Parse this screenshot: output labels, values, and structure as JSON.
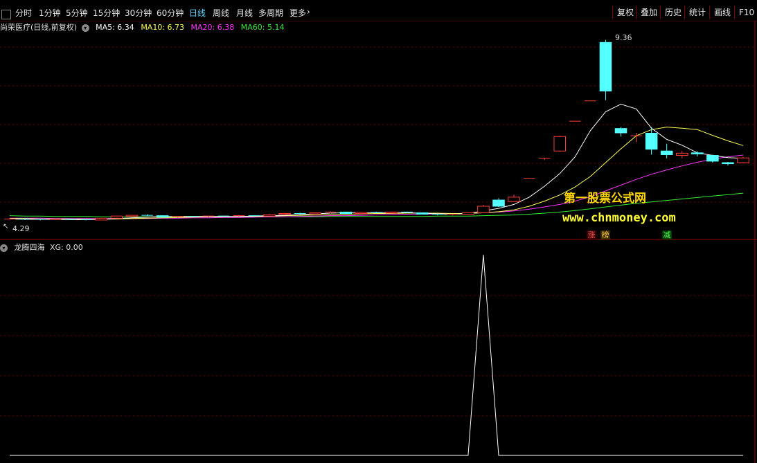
{
  "toolbar": {
    "periods": [
      "分时",
      "1分钟",
      "5分钟",
      "15分钟",
      "30分钟",
      "60分钟",
      "日线",
      "周线",
      "月线",
      "多周期",
      "更多"
    ],
    "active_index": 6,
    "right_buttons": [
      "复权",
      "叠加",
      "历史",
      "统计",
      "画线",
      "F10"
    ]
  },
  "main_info": {
    "title": "尚荣医疗(日线,前复权)",
    "ma5": "MA5: 6.34",
    "ma10": "MA10: 6.73",
    "ma20": "MA20: 6.38",
    "ma60": "MA60: 5.14"
  },
  "price_labels": {
    "high": "9.36",
    "low": "4.29"
  },
  "tags": {
    "zhang": "涨",
    "bang": "榜",
    "jian": "减"
  },
  "watermark": {
    "cn": "第一股票公式网",
    "url": "www.chnmoney.com"
  },
  "indicator_info": {
    "title": "龙腾四海",
    "xg": "XG: 0.00"
  },
  "colors": {
    "up": "#ff3b3b",
    "down": "#54ffff",
    "ma5": "#ffffff",
    "ma10": "#ffff55",
    "ma20": "#ff33ff",
    "ma60": "#33ee33",
    "grid": "#6b0000"
  },
  "chart_data": {
    "type": "candlestick",
    "price_range": [
      4.29,
      9.36
    ],
    "candles": [
      {
        "o": 4.43,
        "c": 4.43,
        "h": 4.45,
        "l": 4.41
      },
      {
        "o": 4.43,
        "c": 4.42,
        "h": 4.44,
        "l": 4.4
      },
      {
        "o": 4.42,
        "c": 4.41,
        "h": 4.43,
        "l": 4.39
      },
      {
        "o": 4.41,
        "c": 4.42,
        "h": 4.43,
        "l": 4.4
      },
      {
        "o": 4.42,
        "c": 4.41,
        "h": 4.43,
        "l": 4.4
      },
      {
        "o": 4.41,
        "c": 4.4,
        "h": 4.42,
        "l": 4.39
      },
      {
        "o": 4.4,
        "c": 4.45,
        "h": 4.46,
        "l": 4.4
      },
      {
        "o": 4.45,
        "c": 4.51,
        "h": 4.52,
        "l": 4.44
      },
      {
        "o": 4.5,
        "c": 4.53,
        "h": 4.54,
        "l": 4.49
      },
      {
        "o": 4.53,
        "c": 4.52,
        "h": 4.56,
        "l": 4.51
      },
      {
        "o": 4.52,
        "c": 4.48,
        "h": 4.53,
        "l": 4.47
      },
      {
        "o": 4.48,
        "c": 4.5,
        "h": 4.51,
        "l": 4.47
      },
      {
        "o": 4.5,
        "c": 4.49,
        "h": 4.51,
        "l": 4.48
      },
      {
        "o": 4.49,
        "c": 4.51,
        "h": 4.52,
        "l": 4.48
      },
      {
        "o": 4.51,
        "c": 4.5,
        "h": 4.52,
        "l": 4.49
      },
      {
        "o": 4.5,
        "c": 4.52,
        "h": 4.54,
        "l": 4.49
      },
      {
        "o": 4.52,
        "c": 4.51,
        "h": 4.53,
        "l": 4.5
      },
      {
        "o": 4.51,
        "c": 4.55,
        "h": 4.57,
        "l": 4.5
      },
      {
        "o": 4.55,
        "c": 4.58,
        "h": 4.6,
        "l": 4.54
      },
      {
        "o": 4.58,
        "c": 4.57,
        "h": 4.6,
        "l": 4.55
      },
      {
        "o": 4.57,
        "c": 4.6,
        "h": 4.61,
        "l": 4.56
      },
      {
        "o": 4.6,
        "c": 4.62,
        "h": 4.64,
        "l": 4.58
      },
      {
        "o": 4.62,
        "c": 4.58,
        "h": 4.63,
        "l": 4.57
      },
      {
        "o": 4.58,
        "c": 4.61,
        "h": 4.62,
        "l": 4.57
      },
      {
        "o": 4.61,
        "c": 4.59,
        "h": 4.63,
        "l": 4.58
      },
      {
        "o": 4.59,
        "c": 4.62,
        "h": 4.63,
        "l": 4.58
      },
      {
        "o": 4.62,
        "c": 4.6,
        "h": 4.63,
        "l": 4.59
      },
      {
        "o": 4.6,
        "c": 4.56,
        "h": 4.61,
        "l": 4.55
      },
      {
        "o": 4.56,
        "c": 4.54,
        "h": 4.58,
        "l": 4.53
      },
      {
        "o": 4.54,
        "c": 4.56,
        "h": 4.57,
        "l": 4.53
      },
      {
        "o": 4.56,
        "c": 4.6,
        "h": 4.61,
        "l": 4.55
      },
      {
        "o": 4.6,
        "c": 4.78,
        "h": 4.82,
        "l": 4.59
      },
      {
        "o": 4.95,
        "c": 4.78,
        "h": 5.0,
        "l": 4.76
      },
      {
        "o": 4.91,
        "c": 5.03,
        "h": 5.1,
        "l": 4.9
      },
      {
        "o": 5.55,
        "c": 5.55,
        "h": 5.55,
        "l": 5.55
      },
      {
        "o": 6.1,
        "c": 6.1,
        "h": 6.12,
        "l": 6.05
      },
      {
        "o": 6.3,
        "c": 6.7,
        "h": 6.72,
        "l": 6.28
      },
      {
        "o": 7.12,
        "c": 7.12,
        "h": 7.12,
        "l": 7.12
      },
      {
        "o": 7.68,
        "c": 7.68,
        "h": 7.68,
        "l": 7.68
      },
      {
        "o": 9.29,
        "c": 7.95,
        "h": 9.36,
        "l": 7.7
      },
      {
        "o": 6.92,
        "c": 6.8,
        "h": 6.96,
        "l": 6.7
      },
      {
        "o": 6.72,
        "c": 6.72,
        "h": 6.8,
        "l": 6.55
      },
      {
        "o": 6.79,
        "c": 6.35,
        "h": 6.96,
        "l": 6.2
      },
      {
        "o": 6.3,
        "c": 6.2,
        "h": 6.5,
        "l": 6.1
      },
      {
        "o": 6.18,
        "c": 6.24,
        "h": 6.3,
        "l": 6.1
      },
      {
        "o": 6.25,
        "c": 6.22,
        "h": 6.3,
        "l": 6.15
      },
      {
        "o": 6.18,
        "c": 6.02,
        "h": 6.2,
        "l": 5.98
      },
      {
        "o": 5.98,
        "c": 5.95,
        "h": 6.0,
        "l": 5.9
      },
      {
        "o": 5.98,
        "c": 6.11,
        "h": 6.14,
        "l": 5.96
      }
    ],
    "ma5": [
      4.43,
      4.42,
      4.42,
      4.42,
      4.41,
      4.41,
      4.42,
      4.44,
      4.46,
      4.48,
      4.5,
      4.5,
      4.5,
      4.5,
      4.5,
      4.5,
      4.51,
      4.52,
      4.53,
      4.55,
      4.57,
      4.59,
      4.6,
      4.6,
      4.6,
      4.6,
      4.6,
      4.59,
      4.57,
      4.56,
      4.58,
      4.65,
      4.72,
      4.83,
      5.03,
      5.33,
      5.68,
      6.14,
      6.86,
      7.38,
      7.59,
      7.46,
      6.93,
      6.62,
      6.46,
      6.25,
      6.18,
      6.12,
      6.1
    ],
    "ma10": [
      4.44,
      4.44,
      4.43,
      4.43,
      4.43,
      4.42,
      4.42,
      4.43,
      4.44,
      4.45,
      4.46,
      4.47,
      4.48,
      4.49,
      4.49,
      4.5,
      4.5,
      4.51,
      4.52,
      4.53,
      4.54,
      4.55,
      4.56,
      4.57,
      4.58,
      4.58,
      4.59,
      4.59,
      4.59,
      4.58,
      4.58,
      4.6,
      4.63,
      4.68,
      4.78,
      4.92,
      5.09,
      5.31,
      5.6,
      5.98,
      6.36,
      6.72,
      6.89,
      6.96,
      6.93,
      6.89,
      6.73,
      6.58,
      6.45
    ],
    "ma20": [
      4.45,
      4.45,
      4.45,
      4.44,
      4.44,
      4.44,
      4.44,
      4.44,
      4.44,
      4.44,
      4.45,
      4.45,
      4.46,
      4.46,
      4.47,
      4.47,
      4.48,
      4.49,
      4.49,
      4.5,
      4.51,
      4.52,
      4.52,
      4.53,
      4.54,
      4.55,
      4.56,
      4.56,
      4.57,
      4.57,
      4.58,
      4.6,
      4.62,
      4.65,
      4.7,
      4.76,
      4.83,
      4.92,
      5.04,
      5.2,
      5.36,
      5.52,
      5.66,
      5.78,
      5.89,
      5.99,
      6.08,
      6.14,
      6.19
    ],
    "ma60": [
      4.52,
      4.51,
      4.51,
      4.5,
      4.5,
      4.5,
      4.49,
      4.49,
      4.49,
      4.49,
      4.49,
      4.49,
      4.49,
      4.49,
      4.49,
      4.49,
      4.49,
      4.49,
      4.49,
      4.49,
      4.49,
      4.5,
      4.5,
      4.5,
      4.5,
      4.5,
      4.5,
      4.5,
      4.51,
      4.51,
      4.51,
      4.52,
      4.53,
      4.54,
      4.56,
      4.59,
      4.62,
      4.66,
      4.71,
      4.76,
      4.81,
      4.86,
      4.9,
      4.94,
      4.98,
      5.02,
      5.06,
      5.1,
      5.14
    ],
    "xg": [
      0,
      0,
      0,
      0,
      0,
      0,
      0,
      0,
      0,
      0,
      0,
      0,
      0,
      0,
      0,
      0,
      0,
      0,
      0,
      0,
      0,
      0,
      0,
      0,
      0,
      0,
      0,
      0,
      0,
      0,
      0,
      1,
      0,
      0,
      0,
      0,
      0,
      0,
      0,
      0,
      0,
      0,
      0,
      0,
      0,
      0,
      0,
      0,
      0
    ]
  }
}
